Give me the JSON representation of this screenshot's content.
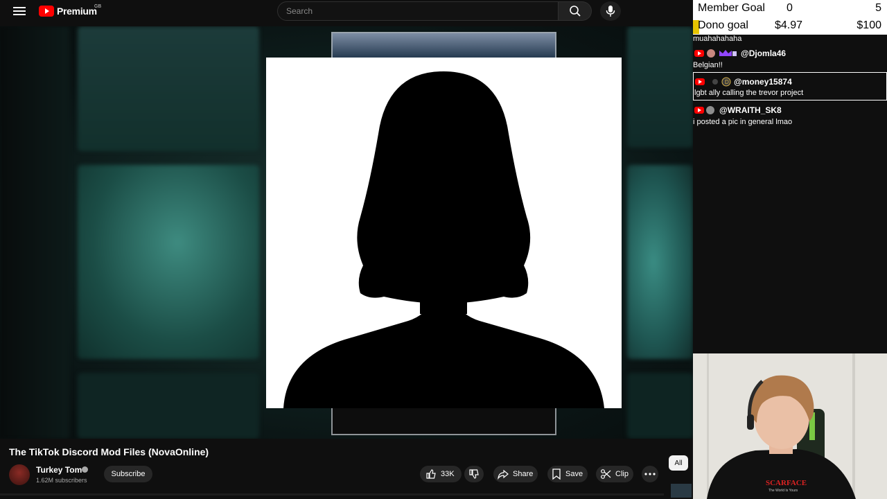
{
  "header": {
    "logo_text": "Premium",
    "logo_region": "GB",
    "search_placeholder": "Search"
  },
  "goals": {
    "member_label": "Member Goal",
    "member_current": "0",
    "member_target": "5",
    "dono_label": "Dono goal",
    "dono_current": "$4.97",
    "dono_target": "$100"
  },
  "chat": [
    {
      "user": "",
      "text": "muahahahaha"
    },
    {
      "user": "@Djomla46",
      "text": "Belgian!!"
    },
    {
      "user": "@money15874",
      "text": "lgbt ally calling the trevor project"
    },
    {
      "user": "@WRAITH_SK8",
      "text": "i posted a pic in general lmao"
    }
  ],
  "video": {
    "title": "The TikTok Discord Mod Files (NovaOnline)",
    "channel": "Turkey Tom",
    "subscribers": "1.62M subscribers",
    "subscribe_label": "Subscribe",
    "like_count": "33K",
    "share_label": "Share",
    "save_label": "Save",
    "clip_label": "Clip",
    "chip_all": "All"
  },
  "webcam": {
    "shirt_text": "SCARFACE",
    "shirt_subtext": "The World Is Yours"
  },
  "colors": {
    "brand_red": "#ff0000",
    "dono_highlight": "#e6c400",
    "background": "#0f0f0f"
  }
}
